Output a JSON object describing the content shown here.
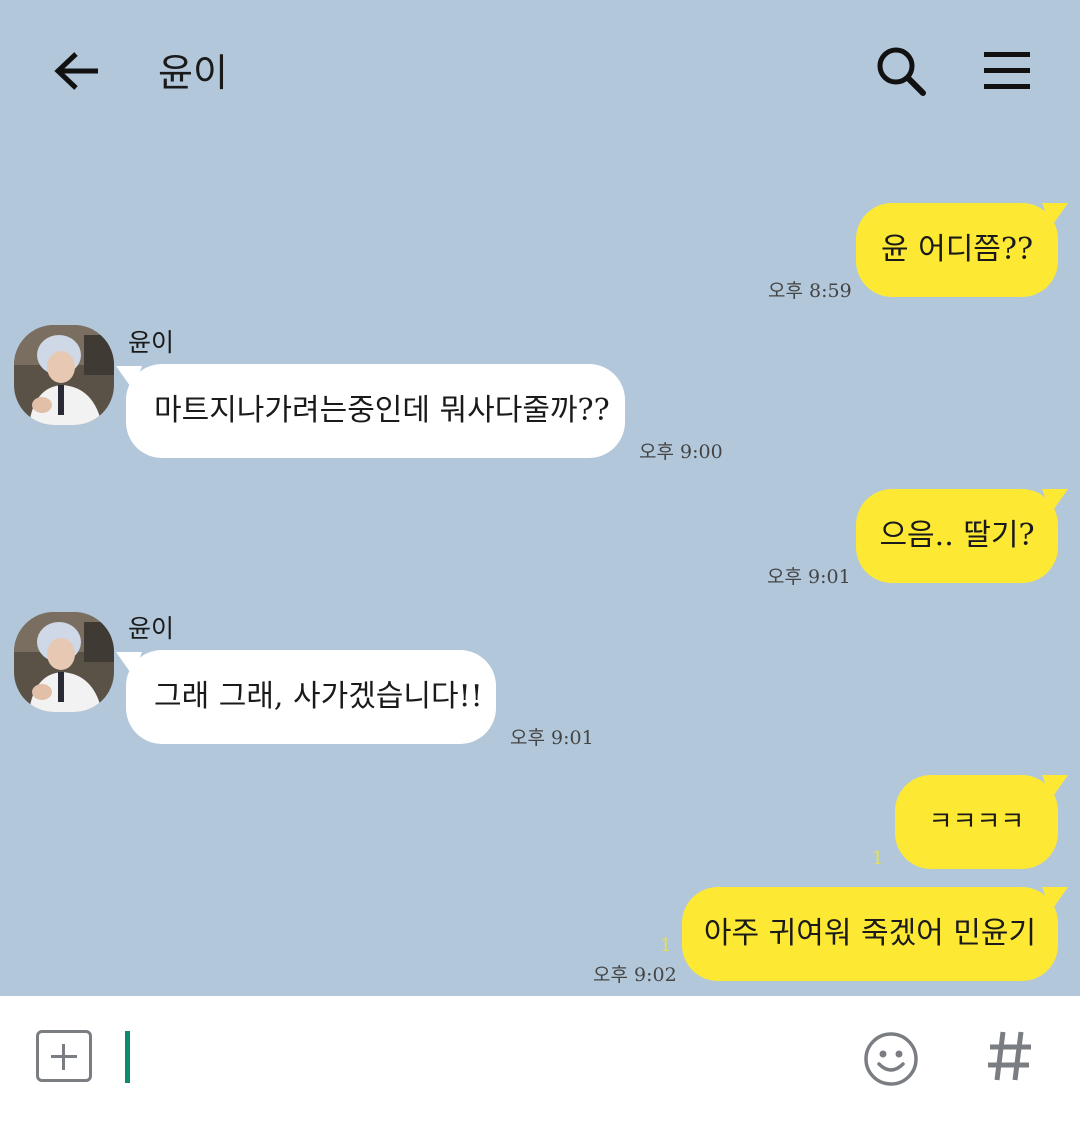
{
  "header": {
    "title": "윤이",
    "back_icon": "arrow-left-icon",
    "search_icon": "search-icon",
    "menu_icon": "hamburger-menu-icon"
  },
  "messages": [
    {
      "from": "me",
      "text": "윤 어디쯤??",
      "time": "오후 8:59",
      "unread": ""
    },
    {
      "from": "them",
      "sender": "윤이",
      "text": "마트지나가려는중인데 뭐사다줄까??",
      "time": "오후 9:00"
    },
    {
      "from": "me",
      "text": "으음.. 딸기?",
      "time": "오후 9:01",
      "unread": ""
    },
    {
      "from": "them",
      "sender": "윤이",
      "text": "그래 그래, 사가겠습니다!!",
      "time": "오후 9:01"
    },
    {
      "from": "me",
      "text": "ㅋㅋㅋㅋ",
      "time": "",
      "unread": "1"
    },
    {
      "from": "me",
      "text": "아주 귀여워 죽겠어 민윤기",
      "time": "오후 9:02",
      "unread": "1"
    }
  ],
  "input": {
    "placeholder": "",
    "value": "",
    "attach_icon": "plus-square-icon",
    "emoji_icon": "smiley-icon",
    "hashtag_icon": "hashtag-icon"
  },
  "colors": {
    "background": "#b2c7da",
    "my_bubble": "#fde934",
    "their_bubble": "#ffffff",
    "cursor": "#0e8a73",
    "unread": "#e8e04a"
  }
}
